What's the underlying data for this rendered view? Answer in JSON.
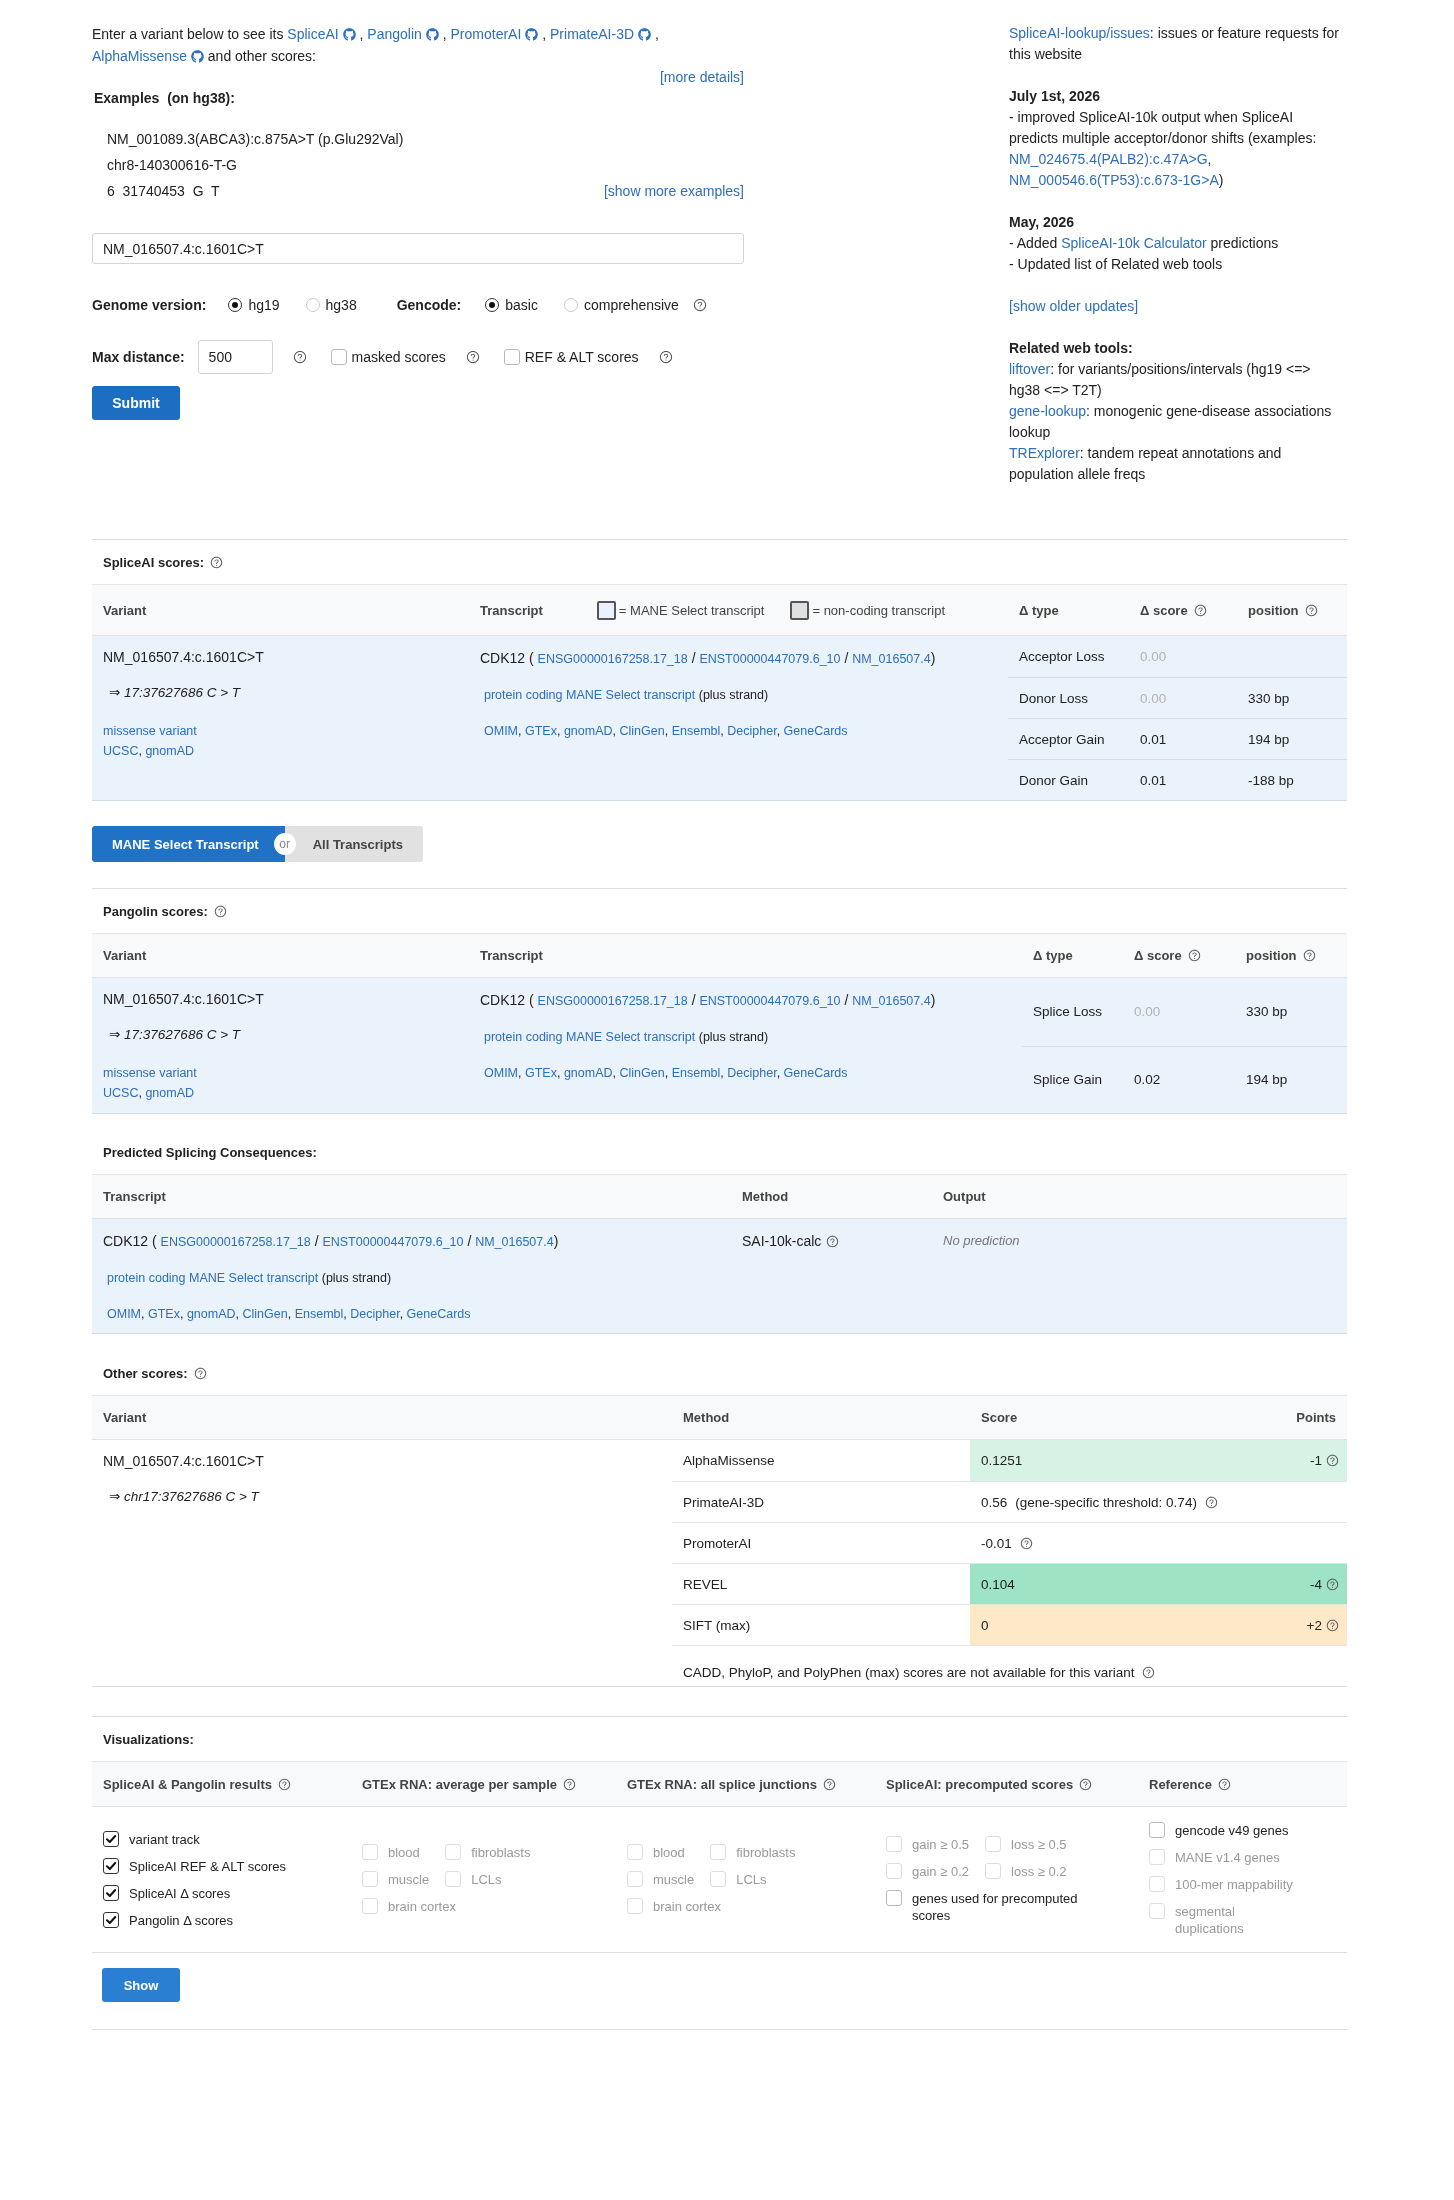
{
  "intro": {
    "before": "Enter a variant below to see its",
    "tools": [
      "SpliceAI",
      "Pangolin",
      "PromoterAI",
      "PrimateAI-3D",
      "AlphaMissense"
    ],
    "separator": ",",
    "after": "and other scores:",
    "more_details": "[more details]"
  },
  "examples": {
    "title": "Examples  (on hg38):",
    "items": [
      "NM_001089.3(ABCA3):c.875A>T (p.Glu292Val)",
      "chr8-140300616-T-G",
      "6  31740453  G  T"
    ],
    "show_more": "[show more examples]"
  },
  "variant_input": {
    "value": "NM_016507.4:c.1601C>T"
  },
  "genome_version": {
    "label": "Genome version:",
    "options": [
      {
        "label": "hg19",
        "selected": true
      },
      {
        "label": "hg38",
        "selected": false
      }
    ]
  },
  "gencode": {
    "label": "Gencode:",
    "options": [
      {
        "label": "basic",
        "selected": true
      },
      {
        "label": "comprehensive",
        "selected": false
      }
    ]
  },
  "max_distance": {
    "label": "Max distance:",
    "value": "500"
  },
  "score_options": [
    {
      "label": "masked scores",
      "checked": false
    },
    {
      "label": "REF & ALT scores",
      "checked": false
    }
  ],
  "submit": "Submit",
  "sidebar": {
    "blocks": [
      {
        "lines": [
          {
            "parts": [
              {
                "kind": "link",
                "text": "SpliceAI-lookup/issues"
              },
              {
                "kind": "text",
                "text": ": issues or feature requests for this website"
              }
            ]
          }
        ]
      },
      {
        "heading": "July 1st, 2026",
        "lines": [
          {
            "parts": [
              {
                "kind": "text",
                "text": "- improved SpliceAI-10k output when SpliceAI predicts multiple acceptor/donor shifts (examples: "
              },
              {
                "kind": "link",
                "text": "NM_024675.4(PALB2):c.47A>G"
              },
              {
                "kind": "text",
                "text": ", "
              },
              {
                "kind": "link",
                "text": "NM_000546.6(TP53):c.673-1G>A"
              },
              {
                "kind": "text",
                "text": ")"
              }
            ]
          }
        ]
      },
      {
        "heading": "May, 2026",
        "lines": [
          {
            "parts": [
              {
                "kind": "text",
                "text": "- Added "
              },
              {
                "kind": "link",
                "text": "SpliceAI-10k Calculator"
              },
              {
                "kind": "text",
                "text": " predictions"
              }
            ]
          },
          {
            "parts": [
              {
                "kind": "text",
                "text": "- Updated list of Related web tools"
              }
            ]
          }
        ]
      },
      {
        "lines": [
          {
            "parts": [
              {
                "kind": "link",
                "text": "[show older updates]"
              }
            ]
          }
        ]
      },
      {
        "heading": "Related web tools:",
        "lines": [
          {
            "parts": [
              {
                "kind": "link",
                "text": "liftover"
              },
              {
                "kind": "text",
                "text": ": for variants/positions/intervals (hg19 <=> hg38 <=> T2T)"
              }
            ]
          },
          {
            "parts": [
              {
                "kind": "link",
                "text": "gene-lookup"
              },
              {
                "kind": "text",
                "text": ": monogenic gene-disease associations lookup"
              }
            ]
          },
          {
            "parts": [
              {
                "kind": "link",
                "text": "TRExplorer"
              },
              {
                "kind": "text",
                "text": ": tandem repeat annotations and population allele freqs"
              }
            ]
          }
        ]
      }
    ]
  },
  "spliceai": {
    "title": "SpliceAI scores:",
    "help": true,
    "columns": [
      {
        "label": "Variant"
      },
      {
        "label": "Transcript"
      },
      {
        "label": "Δ type"
      },
      {
        "label": "Δ score",
        "help": true
      },
      {
        "label": "position",
        "help": true
      }
    ],
    "legend": [
      {
        "label": "= MANE Select transcript",
        "color": "#e8f0fb"
      },
      {
        "label": "= non-coding transcript",
        "color": "#e0e0e0"
      }
    ],
    "variant": {
      "name": "NM_016507.4:c.1601C>T",
      "coords": "⇒ 17:37627686 C > T",
      "consequence": "missense variant",
      "links": [
        "UCSC",
        "gnomAD"
      ],
      "link_separator": ","
    },
    "transcript": {
      "gene": "CDK12",
      "open": "(",
      "ids": [
        "ENSG00000167258.17_18",
        "ENST00000447079.6_10",
        "NM_016507.4"
      ],
      "id_separator": "/",
      "close": ")",
      "tags": [
        "protein coding",
        "MANE Select transcript"
      ],
      "strand": "(plus strand)",
      "links": [
        "OMIM",
        "GTEx",
        "gnomAD",
        "ClinGen",
        "Ensembl",
        "Decipher",
        "GeneCards"
      ],
      "link_separator": ","
    },
    "rows": [
      {
        "type": "Acceptor Loss",
        "score": "0.00",
        "dimmed": true
      },
      {
        "type": "Donor Loss",
        "score": "0.00",
        "position": "330 bp",
        "dimmed": true
      },
      {
        "type": "Acceptor Gain",
        "score": "0.01",
        "position": "194 bp",
        "dimmed": false
      },
      {
        "type": "Donor Gain",
        "score": "0.01",
        "position": "-188 bp",
        "dimmed": false
      }
    ]
  },
  "transcript_toggle": {
    "options": [
      {
        "label": "MANE Select Transcript",
        "selected": true
      },
      {
        "label": "All Transcripts",
        "selected": false
      }
    ],
    "separator": "or"
  },
  "pangolin": {
    "title": "Pangolin scores:",
    "help": true,
    "columns": [
      {
        "label": "Variant"
      },
      {
        "label": "Transcript"
      },
      {
        "label": "Δ type"
      },
      {
        "label": "Δ score",
        "help": true
      },
      {
        "label": "position",
        "help": true
      }
    ],
    "variant": {
      "name": "NM_016507.4:c.1601C>T",
      "coords": "⇒ 17:37627686 C > T",
      "consequence": "missense variant",
      "links": [
        "UCSC",
        "gnomAD"
      ],
      "link_separator": ","
    },
    "transcript": {
      "gene": "CDK12",
      "open": "(",
      "ids": [
        "ENSG00000167258.17_18",
        "ENST00000447079.6_10",
        "NM_016507.4"
      ],
      "id_separator": "/",
      "close": ")",
      "tags": [
        "protein coding",
        "MANE Select transcript"
      ],
      "strand": "(plus strand)",
      "links": [
        "OMIM",
        "GTEx",
        "gnomAD",
        "ClinGen",
        "Ensembl",
        "Decipher",
        "GeneCards"
      ],
      "link_separator": ","
    },
    "rows": [
      {
        "type": "Splice Loss",
        "score": "0.00",
        "position": "330 bp",
        "dimmed": true
      },
      {
        "type": "Splice Gain",
        "score": "0.02",
        "position": "194 bp",
        "dimmed": false
      }
    ]
  },
  "predicted": {
    "title": "Predicted Splicing Consequences:",
    "columns": [
      {
        "label": "Transcript"
      },
      {
        "label": "Method"
      },
      {
        "label": "Output"
      }
    ],
    "rows": [
      {
        "transcript": {
          "gene": "CDK12",
          "open": "(",
          "ids": [
            "ENSG00000167258.17_18",
            "ENST00000447079.6_10",
            "NM_016507.4"
          ],
          "id_separator": "/",
          "close": ")",
          "tags": [
            "protein coding",
            "MANE Select transcript"
          ],
          "strand": "(plus strand)",
          "links": [
            "OMIM",
            "GTEx",
            "gnomAD",
            "ClinGen",
            "Ensembl",
            "Decipher",
            "GeneCards"
          ],
          "link_separator": ","
        },
        "method": "SAI-10k-calc",
        "output": "No prediction"
      }
    ]
  },
  "other": {
    "title": "Other scores:",
    "help": true,
    "columns": [
      {
        "label": "Variant"
      },
      {
        "label": "Method"
      },
      {
        "label": "Score"
      },
      {
        "label": "Points"
      }
    ],
    "variant": {
      "name": "NM_016507.4:c.1601C>T",
      "coords": "⇒ chr17:37627686 C > T"
    },
    "rows": [
      {
        "method": "AlphaMissense",
        "score": "0.1251",
        "points": "-1",
        "color": "#d7f3e5"
      },
      {
        "method": "PrimateAI-3D",
        "score": "0.56",
        "note": "(gene-specific threshold: 0.74)"
      },
      {
        "method": "PromoterAI",
        "score": "-0.01"
      },
      {
        "method": "REVEL",
        "score": "0.104",
        "points": "-4",
        "color": "#9ee3c4"
      },
      {
        "method": "SIFT (max)",
        "score": "0",
        "points": "+2",
        "color": "#fde9c7"
      }
    ],
    "note": "CADD, PhyloP, and PolyPhen (max) scores are not available for this variant"
  },
  "visualizations": {
    "title": "Visualizations:",
    "groups": [
      {
        "label": "SpliceAI & Pangolin results",
        "help": true,
        "rows": [
          {
            "options": [
              {
                "label": "variant track",
                "checked": true,
                "disabled": false
              }
            ]
          },
          {
            "options": [
              {
                "label": "SpliceAI REF & ALT scores",
                "checked": true,
                "disabled": false
              }
            ]
          },
          {
            "options": [
              {
                "label": "SpliceAI Δ scores",
                "checked": true,
                "disabled": false
              }
            ]
          },
          {
            "options": [
              {
                "label": "Pangolin Δ scores",
                "checked": true,
                "disabled": false
              }
            ]
          }
        ]
      },
      {
        "label": "GTEx RNA: average per sample",
        "help": true,
        "rows": [
          {
            "options": [
              {
                "label": "blood",
                "checked": false,
                "disabled": true
              },
              {
                "label": "fibroblasts",
                "checked": false,
                "disabled": true
              }
            ]
          },
          {
            "options": [
              {
                "label": "muscle",
                "checked": false,
                "disabled": true
              },
              {
                "label": "LCLs",
                "checked": false,
                "disabled": true
              }
            ]
          },
          {
            "options": [
              {
                "label": "brain cortex",
                "checked": false,
                "disabled": true
              }
            ]
          }
        ]
      },
      {
        "label": "GTEx RNA: all splice junctions",
        "help": true,
        "rows": [
          {
            "options": [
              {
                "label": "blood",
                "checked": false,
                "disabled": true
              },
              {
                "label": "fibroblasts",
                "checked": false,
                "disabled": true
              }
            ]
          },
          {
            "options": [
              {
                "label": "muscle",
                "checked": false,
                "disabled": true
              },
              {
                "label": "LCLs",
                "checked": false,
                "disabled": true
              }
            ]
          },
          {
            "options": [
              {
                "label": "brain cortex",
                "checked": false,
                "disabled": true
              }
            ]
          }
        ]
      },
      {
        "label": "SpliceAI: precomputed scores",
        "help": true,
        "rows": [
          {
            "options": [
              {
                "label": "gain ≥ 0.5",
                "checked": false,
                "disabled": true
              },
              {
                "label": "loss ≥ 0.5",
                "checked": false,
                "disabled": true
              }
            ]
          },
          {
            "options": [
              {
                "label": "gain ≥ 0.2",
                "checked": false,
                "disabled": true
              },
              {
                "label": "loss ≥ 0.2",
                "checked": false,
                "disabled": true
              }
            ]
          },
          {
            "options": [
              {
                "label": "genes used for precomputed scores",
                "checked": false,
                "disabled": false
              }
            ]
          }
        ]
      },
      {
        "label": "Reference",
        "help": true,
        "rows": [
          {
            "options": [
              {
                "label": "gencode v49 genes",
                "checked": false,
                "disabled": false
              }
            ]
          },
          {
            "options": [
              {
                "label": "MANE v1.4 genes",
                "checked": false,
                "disabled": true
              }
            ]
          },
          {
            "options": [
              {
                "label": "100-mer mappability",
                "checked": false,
                "disabled": true
              }
            ]
          },
          {
            "options": [
              {
                "label": "segmental duplications",
                "checked": false,
                "disabled": true
              }
            ]
          }
        ]
      }
    ],
    "button": "Show"
  }
}
